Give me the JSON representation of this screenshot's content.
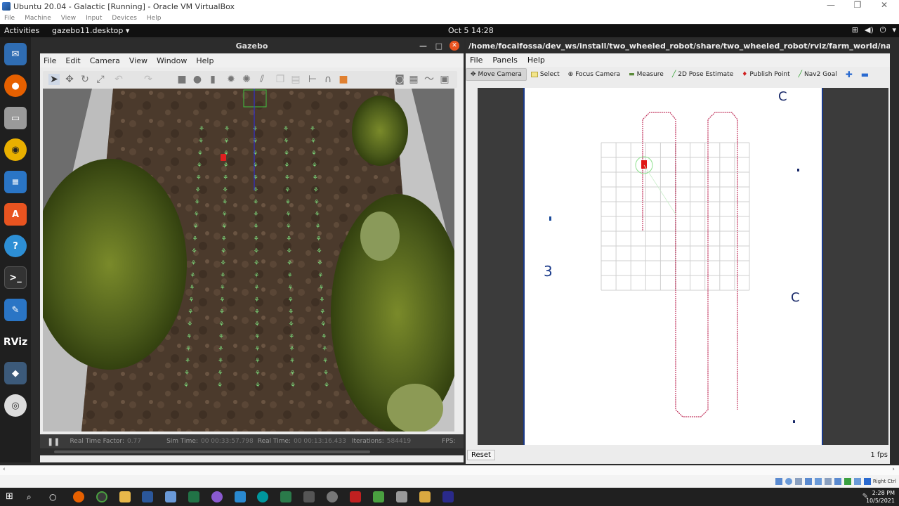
{
  "vbox": {
    "title": "Ubuntu 20.04 - Galactic [Running] - Oracle VM VirtualBox",
    "menu": [
      "File",
      "Machine",
      "View",
      "Input",
      "Devices",
      "Help"
    ]
  },
  "ubuntu_bar": {
    "activities": "Activities",
    "app_name": "gazebo11.desktop ▾",
    "clock": "Oct 5  14:28"
  },
  "gazebo": {
    "title": "Gazebo",
    "menu": [
      "File",
      "Edit",
      "Camera",
      "View",
      "Window",
      "Help"
    ],
    "status": {
      "rtf_label": "Real Time Factor:",
      "rtf_value": "0.77",
      "sim_label": "Sim Time:",
      "sim_value": "00 00:33:57.798",
      "real_label": "Real Time:",
      "real_value": "00 00:13:16.433",
      "iter_label": "Iterations:",
      "iter_value": "584419",
      "fps_label": "FPS:"
    }
  },
  "rviz": {
    "title": "/home/focalfossa/dev_ws/install/two_wheeled_robot/share/two_wheeled_robot/rviz/farm_world/nav2_config.rvi...",
    "menu": [
      "File",
      "Panels",
      "Help"
    ],
    "tools": [
      "Move Camera",
      "Select",
      "Focus Camera",
      "Measure",
      "2D Pose Estimate",
      "Publish Point",
      "Nav2 Goal"
    ],
    "reset": "Reset",
    "fps": "1 fps"
  },
  "taskbar": {
    "time": "2:28 PM",
    "date": "10/5/2021",
    "right_ctrl": "Right Ctrl"
  }
}
